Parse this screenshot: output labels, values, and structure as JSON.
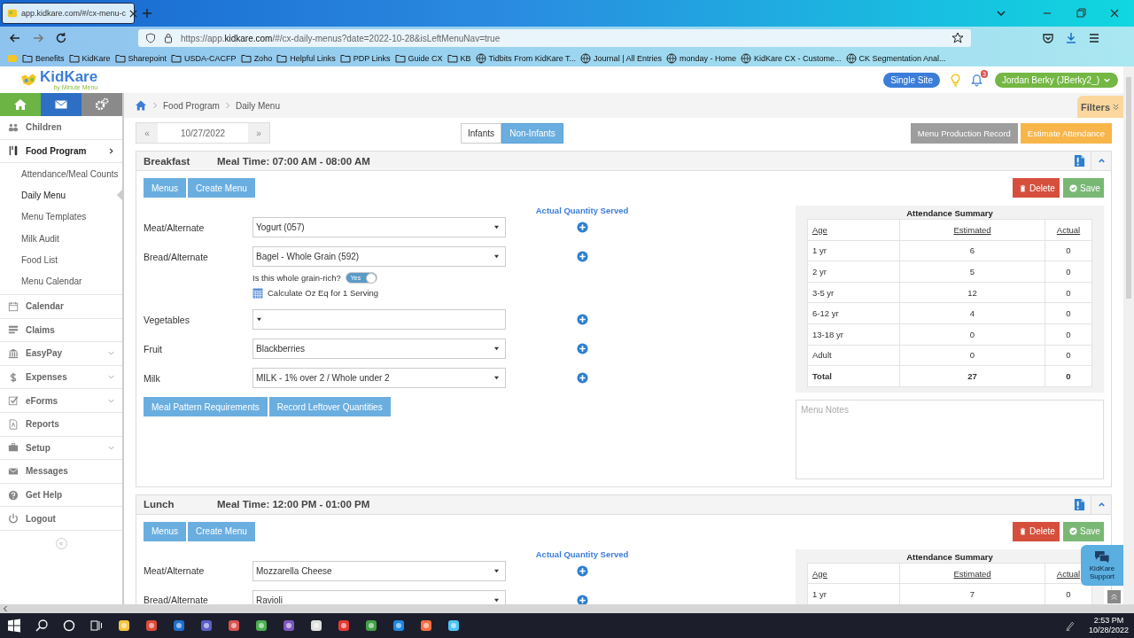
{
  "browser": {
    "tab_title": "app.kidkare.com/#/cx-menu-c",
    "url": "https://app.**kidkare.com**/#/cx-daily-menus?date=2022-10-28&isLeftMenuNav=true",
    "bookmarks": [
      {
        "label": "Benefits",
        "kind": "folder"
      },
      {
        "label": "KidKare",
        "kind": "folder"
      },
      {
        "label": "Sharepoint",
        "kind": "folder"
      },
      {
        "label": "USDA-CACFP",
        "kind": "folder"
      },
      {
        "label": "Zoho",
        "kind": "folder"
      },
      {
        "label": "Helpful Links",
        "kind": "folder"
      },
      {
        "label": "PDP Links",
        "kind": "folder"
      },
      {
        "label": "Guide CX",
        "kind": "folder"
      },
      {
        "label": "KB",
        "kind": "folder"
      },
      {
        "label": "Tidbits From KidKare T...",
        "kind": "site"
      },
      {
        "label": "Journal | All Entries",
        "kind": "site"
      },
      {
        "label": "monday - Home",
        "kind": "site"
      },
      {
        "label": "KidKare CX - Custome...",
        "kind": "site"
      },
      {
        "label": "CK Segmentation Anal...",
        "kind": "site"
      }
    ]
  },
  "header": {
    "logo": "KidKare",
    "logo_tagline": "by Minute Menu",
    "site_button": "Single Site",
    "notification_count": "3",
    "user": "Jordan Berky (JBerky2_)"
  },
  "sidebar": {
    "items": [
      {
        "label": "Children",
        "selected": false,
        "has_submenu": false
      },
      {
        "label": "Food Program",
        "selected": true,
        "has_submenu": false,
        "children": [
          {
            "label": "Attendance/Meal Counts",
            "selected": false
          },
          {
            "label": "Daily Menu",
            "selected": true
          },
          {
            "label": "Menu Templates",
            "selected": false
          },
          {
            "label": "Milk Audit",
            "selected": false
          },
          {
            "label": "Food List",
            "selected": false
          },
          {
            "label": "Menu Calendar",
            "selected": false
          }
        ]
      },
      {
        "label": "Calendar",
        "selected": false,
        "has_submenu": false
      },
      {
        "label": "Claims",
        "selected": false,
        "has_submenu": false
      },
      {
        "label": "EasyPay",
        "selected": false,
        "has_submenu": true
      },
      {
        "label": "Expenses",
        "selected": false,
        "has_submenu": true
      },
      {
        "label": "eForms",
        "selected": false,
        "has_submenu": true
      },
      {
        "label": "Reports",
        "selected": false,
        "has_submenu": false
      },
      {
        "label": "Setup",
        "selected": false,
        "has_submenu": true
      },
      {
        "label": "Messages",
        "selected": false,
        "has_submenu": false
      },
      {
        "label": "Get Help",
        "selected": false,
        "has_submenu": false
      },
      {
        "label": "Logout",
        "selected": false,
        "has_submenu": false
      }
    ],
    "collapse": "«"
  },
  "breadcrumb": [
    "Food Program",
    "Daily Menu"
  ],
  "filters": "Filters",
  "date_nav": {
    "prev": "«",
    "date": "10/27/2022",
    "next": "»"
  },
  "meal_types": [
    {
      "label": "Infants",
      "selected": false
    },
    {
      "label": "Non-Infants",
      "selected": true
    }
  ],
  "actions": [
    {
      "label": "Menu Production Record",
      "kind": "secondary"
    },
    {
      "label": "Estimate Attendance",
      "kind": "warning"
    }
  ],
  "meals": [
    {
      "name": "Breakfast",
      "meal_time": "Meal Time: 07:00 AM - 08:00 AM",
      "menu_buttons": [
        "Menus",
        "Create Menu"
      ],
      "delete": "Delete",
      "save": "Save",
      "quantity_heading": "Actual Quantity Served",
      "components": [
        {
          "label": "Meat/Alternate",
          "value": "Yogurt (057)"
        },
        {
          "label": "Bread/Alternate",
          "value": "Bagel - Whole Grain (592)",
          "whole_grain": {
            "question": "Is this whole grain-rich?",
            "toggle": "Yes",
            "on": true,
            "calculate": "Calculate Oz Eq for 1 Serving"
          }
        },
        {
          "label": "Vegetables"
        },
        {
          "label": "Fruit",
          "value": "Blackberries"
        },
        {
          "label": "Milk",
          "value": "MILK - 1% over 2 / Whole under 2"
        }
      ],
      "bottom_buttons": [
        "Meal Pattern Requirements",
        "Record Leftover Quantities"
      ],
      "attendance": {
        "title": "Attendance Summary",
        "columns": [
          "Age",
          "Estimated",
          "Actual"
        ],
        "rows": [
          [
            "1 yr",
            "6",
            "0"
          ],
          [
            "2 yr",
            "5",
            "0"
          ],
          [
            "3-5 yr",
            "12",
            "0"
          ],
          [
            "6-12 yr",
            "4",
            "0"
          ],
          [
            "13-18 yr",
            "0",
            "0"
          ],
          [
            "Adult",
            "0",
            "0"
          ]
        ],
        "total": [
          "Total",
          "27",
          "0"
        ]
      },
      "notes_placeholder": "Menu Notes"
    },
    {
      "name": "Lunch",
      "meal_time": "Meal Time: 12:00 PM - 01:00 PM",
      "menu_buttons": [
        "Menus",
        "Create Menu"
      ],
      "delete": "Delete",
      "save": "Save",
      "quantity_heading": "Actual Quantity Served",
      "components": [
        {
          "label": "Meat/Alternate",
          "value": "Mozzarella Cheese"
        },
        {
          "label": "Bread/Alternate",
          "value": "Ravioli"
        }
      ],
      "attendance": {
        "title": "Attendance Summary",
        "columns": [
          "Age",
          "Estimated",
          "Actual"
        ],
        "rows": [
          [
            "1 yr",
            "7",
            "0"
          ]
        ]
      }
    }
  ],
  "support_widget": "KidKare Support",
  "taskbar": {
    "time": "2:53 PM",
    "date": "10/28/2022"
  }
}
